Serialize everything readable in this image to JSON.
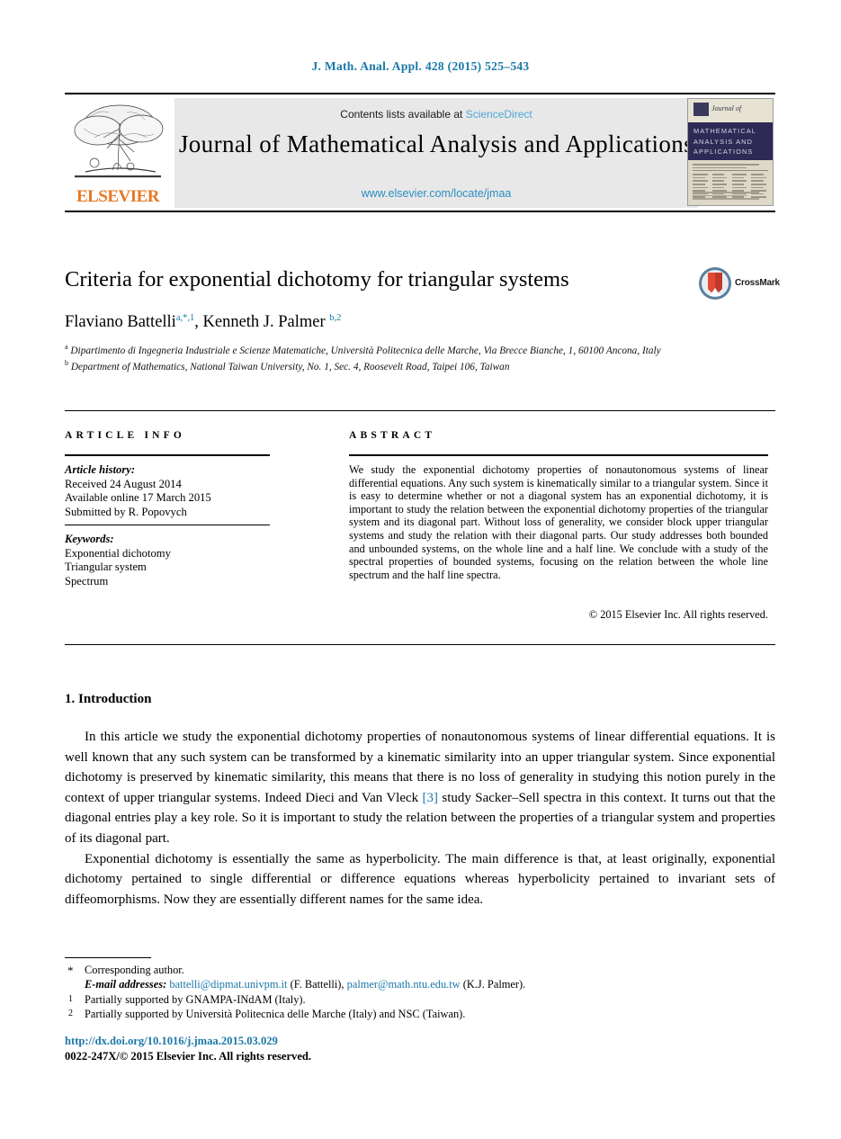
{
  "running_head": "J. Math. Anal. Appl. 428 (2015) 525–543",
  "masthead": {
    "contents_prefix": "Contents lists available at ",
    "sciencedirect_label": "ScienceDirect",
    "journal_title": "Journal of Mathematical Analysis and Applications",
    "journal_url": "www.elsevier.com/locate/jmaa",
    "publisher_wordmark": "ELSEVIER",
    "cover": {
      "journal_of": "Journal of",
      "band_line1": "MATHEMATICAL",
      "band_line2": "ANALYSIS AND",
      "band_line3": "APPLICATIONS"
    }
  },
  "article": {
    "title": "Criteria for exponential dichotomy for triangular systems",
    "crossmark_label": "CrossMark",
    "authors_html": "Flaviano Battelli<sup>a,*,1</sup>, Kenneth J. Palmer <sup>b,2</sup>",
    "affiliation_a": "Dipartimento di Ingegneria Industriale e Scienze Matematiche, Università Politecnica delle Marche, Via Brecce Bianche, 1, 60100 Ancona, Italy",
    "affiliation_b": "Department of Mathematics, National Taiwan University, No. 1, Sec. 4, Roosevelt Road, Taipei 106, Taiwan"
  },
  "info": {
    "heading": "ARTICLE INFO",
    "history_label": "Article history:",
    "history": [
      "Received 24 August 2014",
      "Available online 17 March 2015",
      "Submitted by R. Popovych"
    ],
    "keywords_label": "Keywords:",
    "keywords": [
      "Exponential dichotomy",
      "Triangular system",
      "Spectrum"
    ]
  },
  "abstract": {
    "heading": "ABSTRACT",
    "text": "We study the exponential dichotomy properties of nonautonomous systems of linear differential equations. Any such system is kinematically similar to a triangular system. Since it is easy to determine whether or not a diagonal system has an exponential dichotomy, it is important to study the relation between the exponential dichotomy properties of the triangular system and its diagonal part. Without loss of generality, we consider block upper triangular systems and study the relation with their diagonal parts. Our study addresses both bounded and unbounded systems, on the whole line and a half line. We conclude with a study of the spectral properties of bounded systems, focusing on the relation between the whole line spectrum and the half line spectra.",
    "copyright": "© 2015 Elsevier Inc. All rights reserved."
  },
  "body": {
    "section_heading": "1. Introduction",
    "paragraph1_a": "In this article we study the exponential dichotomy properties of nonautonomous systems of linear differential equations. It is well known that any such system can be transformed by a kinematic similarity into an upper triangular system. Since exponential dichotomy is preserved by kinematic similarity, this means that there is no loss of generality in studying this notion purely in the context of upper triangular systems. Indeed Dieci and Van Vleck ",
    "paragraph1_cite": "[3]",
    "paragraph1_b": " study Sacker–Sell spectra in this context. It turns out that the diagonal entries play a key role. So it is important to study the relation between the properties of a triangular system and properties of its diagonal part.",
    "paragraph2": "Exponential dichotomy is essentially the same as hyperbolicity. The main difference is that, at least originally, exponential dichotomy pertained to single differential or difference equations whereas hyperbolicity pertained to invariant sets of diffeomorphisms. Now they are essentially different names for the same idea."
  },
  "footnotes": {
    "corresponding_mark": "*",
    "corresponding": "Corresponding author.",
    "email_label": "E-mail addresses:",
    "email1": "battelli@dipmat.univpm.it",
    "email1_owner": " (F. Battelli), ",
    "email2": "palmer@math.ntu.edu.tw",
    "email2_owner": " (K.J. Palmer).",
    "note1_mark": "1",
    "note1": "Partially supported by GNAMPA-INdAM (Italy).",
    "note2_mark": "2",
    "note2": "Partially supported by Università Politecnica delle Marche (Italy) and NSC (Taiwan)."
  },
  "footer": {
    "doi": "http://dx.doi.org/10.1016/j.jmaa.2015.03.029",
    "copyright": "0022-247X/© 2015 Elsevier Inc. All rights reserved."
  },
  "colors": {
    "link_blue": "#1a78a8",
    "sciencedirect_blue": "#4da8d8",
    "elsevier_orange": "#e87722",
    "cover_band": "#2e2a55"
  }
}
